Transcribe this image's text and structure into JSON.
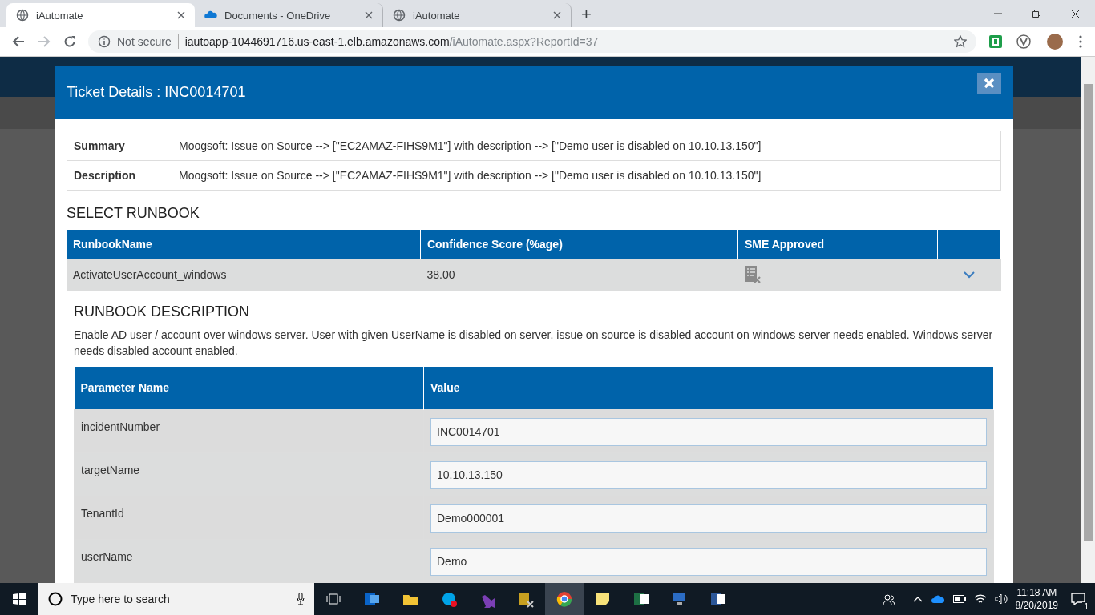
{
  "browser": {
    "tabs": [
      {
        "title": "iAutomate",
        "kind": "globe",
        "selected": true
      },
      {
        "title": "Documents - OneDrive",
        "kind": "cloud",
        "selected": false
      },
      {
        "title": "iAutomate",
        "kind": "globe",
        "selected": false
      }
    ],
    "new_tab": "+",
    "address": {
      "security": "Not secure",
      "host": "iautoapp-1044691716.us-east-1.elb.amazonaws.com",
      "path": "/iAutomate.aspx?ReportId=37"
    }
  },
  "modal": {
    "title": "Ticket Details : INC0014701",
    "details": [
      {
        "label": "Summary",
        "value": "Moogsoft: Issue on Source --> [\"EC2AMAZ-FIHS9M1\"] with description --> [\"Demo user is disabled on 10.10.13.150\"]"
      },
      {
        "label": "Description",
        "value": "Moogsoft: Issue on Source --> [\"EC2AMAZ-FIHS9M1\"] with description --> [\"Demo user is disabled on 10.10.13.150\"]"
      }
    ],
    "runbook_heading": "SELECT RUNBOOK",
    "runbook_table": {
      "columns": [
        "RunbookName",
        "Confidence Score (%age)",
        "SME Approved"
      ],
      "rows": [
        {
          "name": "ActivateUserAccount_windows",
          "score": "38.00",
          "sme_approved": false,
          "expanded": true
        }
      ]
    },
    "description_heading": "RUNBOOK DESCRIPTION",
    "description": "Enable AD user / account over windows server. User with given UserName is disabled on server. issue on source is disabled account on windows server needs enabled. Windows server needs disabled account enabled.",
    "parameters": {
      "columns": [
        "Parameter Name",
        "Value"
      ],
      "rows": [
        {
          "name": "incidentNumber",
          "value": "INC0014701"
        },
        {
          "name": "targetName",
          "value": "10.10.13.150"
        },
        {
          "name": "TenantId",
          "value": "Demo000001"
        },
        {
          "name": "userName",
          "value": "Demo"
        }
      ]
    }
  },
  "taskbar": {
    "search_placeholder": "Type here to search",
    "apps": [
      {
        "kind": "outlook",
        "color": "#0a64c8"
      },
      {
        "kind": "explorer",
        "color": "#f2c335"
      },
      {
        "kind": "skype",
        "color": "#00a3e8"
      },
      {
        "kind": "visualstudio",
        "color": "#7b3fb5"
      },
      {
        "kind": "database",
        "color": "#c8a020"
      },
      {
        "kind": "chrome",
        "color": "#e34133"
      },
      {
        "kind": "notes",
        "color": "#f7e27a"
      },
      {
        "kind": "excel",
        "color": "#1d7044"
      },
      {
        "kind": "network",
        "color": "#2b6cc4"
      },
      {
        "kind": "word",
        "color": "#2b579a"
      }
    ],
    "time": "11:18 AM",
    "date": "8/20/2019",
    "notifications": "1"
  }
}
